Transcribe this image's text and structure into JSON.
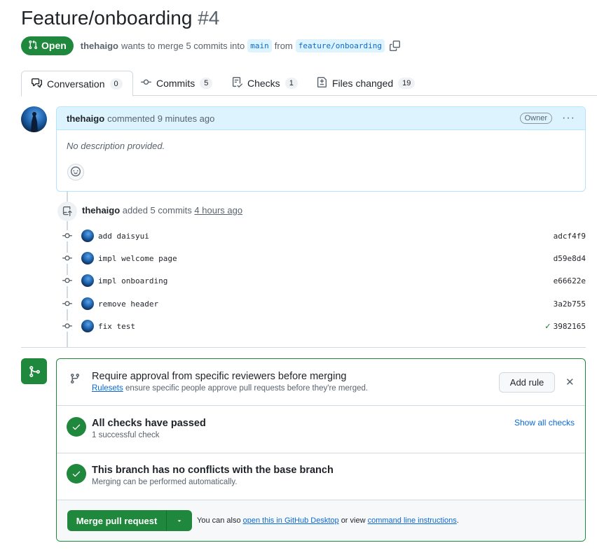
{
  "pr": {
    "title": "Feature/onboarding",
    "number": "#4",
    "state": "Open",
    "author": "thehaigo",
    "merge_text": "wants to merge 5 commits into",
    "base_branch": "main",
    "from_text": "from",
    "head_branch": "feature/onboarding"
  },
  "tabs": [
    {
      "label": "Conversation",
      "count": "0",
      "icon": "comment-discussion-icon"
    },
    {
      "label": "Commits",
      "count": "5",
      "icon": "git-commit-icon"
    },
    {
      "label": "Checks",
      "count": "1",
      "icon": "checklist-icon"
    },
    {
      "label": "Files changed",
      "count": "19",
      "icon": "file-diff-icon"
    }
  ],
  "comment": {
    "author": "thehaigo",
    "action": "commented 9 minutes ago",
    "badge": "Owner",
    "menu": "···",
    "body": "No description provided."
  },
  "commits_event": {
    "author": "thehaigo",
    "action": "added 5 commits",
    "time": "4 hours ago"
  },
  "commits": [
    {
      "message": "add daisyui",
      "sha": "adcf4f9",
      "status": ""
    },
    {
      "message": "impl welcome page",
      "sha": "d59e8d4",
      "status": ""
    },
    {
      "message": "impl onboarding",
      "sha": "e66622e",
      "status": ""
    },
    {
      "message": "remove header",
      "sha": "3a2b755",
      "status": ""
    },
    {
      "message": "fix test",
      "sha": "3982165",
      "status": "✓"
    }
  ],
  "mergebox": {
    "rules": {
      "title": "Require approval from specific reviewers before merging",
      "link": "Rulesets",
      "sub": "ensure specific people approve pull requests before they're merged.",
      "add_rule": "Add rule",
      "close": "✕"
    },
    "checks": {
      "title": "All checks have passed",
      "sub": "1 successful check",
      "show_all": "Show all checks"
    },
    "conflicts": {
      "title": "This branch has no conflicts with the base branch",
      "sub": "Merging can be performed automatically."
    },
    "footer": {
      "merge_label": "Merge pull request",
      "text_pre": "You can also",
      "link1": "open this in GitHub Desktop",
      "text_mid": "or view",
      "link2": "command line instructions",
      "text_post": "."
    }
  },
  "colors": {
    "green": "#1f883d",
    "blue": "#0969da",
    "comment_header": "#ddf4ff"
  }
}
